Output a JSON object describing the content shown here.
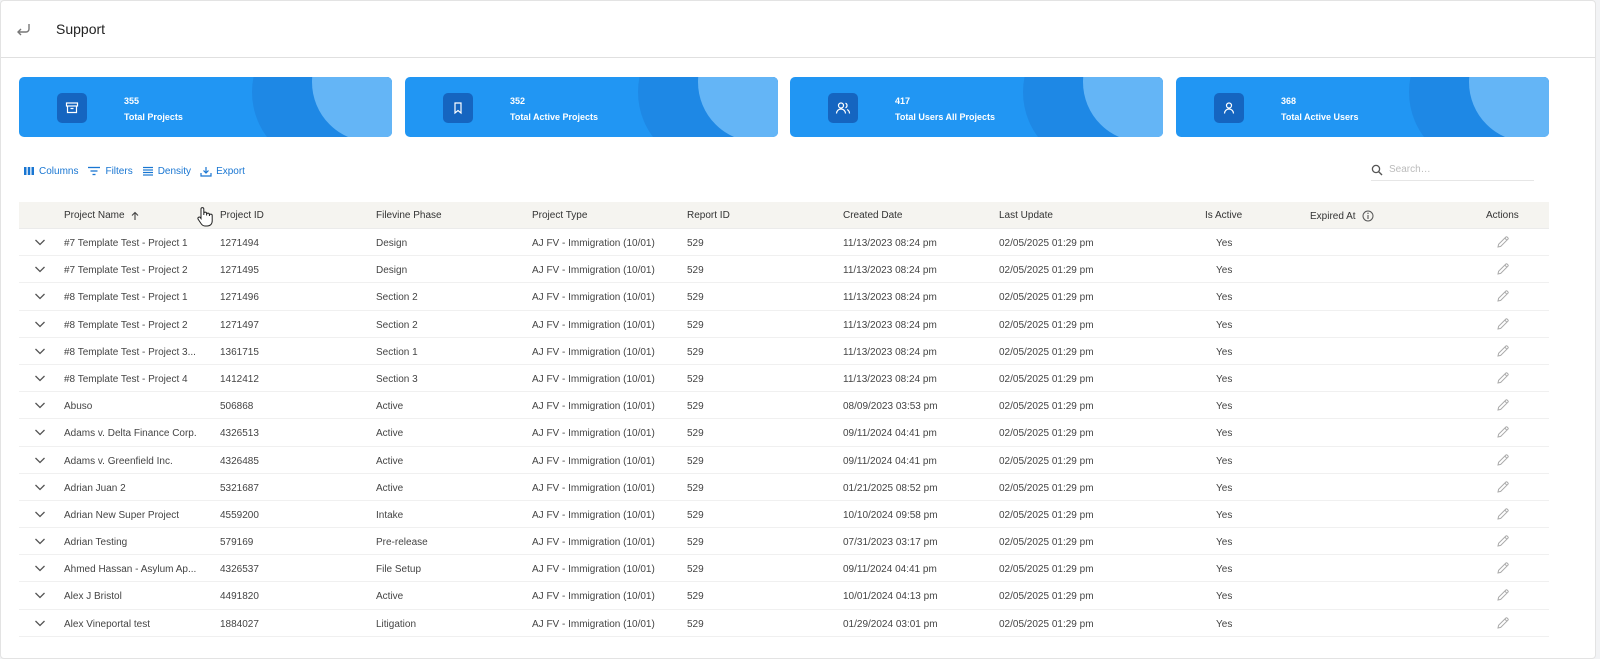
{
  "header": {
    "title": "Support"
  },
  "cards": [
    {
      "value": "355",
      "label": "Total Projects",
      "icon": "archive-icon"
    },
    {
      "value": "352",
      "label": "Total Active Projects",
      "icon": "bookmark-icon"
    },
    {
      "value": "417",
      "label": "Total Users All Projects",
      "icon": "users-icon"
    },
    {
      "value": "368",
      "label": "Total Active Users",
      "icon": "user-icon"
    }
  ],
  "toolbar": {
    "columns": "Columns",
    "filters": "Filters",
    "density": "Density",
    "export": "Export"
  },
  "search": {
    "placeholder": "Search…"
  },
  "columns": {
    "project_name": "Project Name",
    "project_id": "Project ID",
    "filevine_phase": "Filevine Phase",
    "project_type": "Project Type",
    "report_id": "Report ID",
    "created_date": "Created Date",
    "last_update": "Last Update",
    "is_active": "Is Active",
    "expired_at": "Expired At",
    "actions": "Actions"
  },
  "rows": [
    [
      "#7 Template Test - Project 1",
      "1271494",
      "Design",
      "AJ FV - Immigration (10/01)",
      "529",
      "11/13/2023 08:24 pm",
      "02/05/2025 01:29 pm",
      "Yes"
    ],
    [
      "#7 Template Test - Project 2",
      "1271495",
      "Design",
      "AJ FV - Immigration (10/01)",
      "529",
      "11/13/2023 08:24 pm",
      "02/05/2025 01:29 pm",
      "Yes"
    ],
    [
      "#8 Template Test - Project 1",
      "1271496",
      "Section 2",
      "AJ FV - Immigration (10/01)",
      "529",
      "11/13/2023 08:24 pm",
      "02/05/2025 01:29 pm",
      "Yes"
    ],
    [
      "#8 Template Test - Project 2",
      "1271497",
      "Section 2",
      "AJ FV - Immigration (10/01)",
      "529",
      "11/13/2023 08:24 pm",
      "02/05/2025 01:29 pm",
      "Yes"
    ],
    [
      "#8 Template Test - Project 3...",
      "1361715",
      "Section 1",
      "AJ FV - Immigration (10/01)",
      "529",
      "11/13/2023 08:24 pm",
      "02/05/2025 01:29 pm",
      "Yes"
    ],
    [
      "#8 Template Test - Project 4",
      "1412412",
      "Section 3",
      "AJ FV - Immigration (10/01)",
      "529",
      "11/13/2023 08:24 pm",
      "02/05/2025 01:29 pm",
      "Yes"
    ],
    [
      "Abuso",
      "506868",
      "Active",
      "AJ FV - Immigration (10/01)",
      "529",
      "08/09/2023 03:53 pm",
      "02/05/2025 01:29 pm",
      "Yes"
    ],
    [
      "Adams v. Delta Finance Corp.",
      "4326513",
      "Active",
      "AJ FV - Immigration (10/01)",
      "529",
      "09/11/2024 04:41 pm",
      "02/05/2025 01:29 pm",
      "Yes"
    ],
    [
      "Adams v. Greenfield Inc.",
      "4326485",
      "Active",
      "AJ FV - Immigration (10/01)",
      "529",
      "09/11/2024 04:41 pm",
      "02/05/2025 01:29 pm",
      "Yes"
    ],
    [
      "Adrian Juan 2",
      "5321687",
      "Active",
      "AJ FV - Immigration (10/01)",
      "529",
      "01/21/2025 08:52 pm",
      "02/05/2025 01:29 pm",
      "Yes"
    ],
    [
      "Adrian New Super Project",
      "4559200",
      "Intake",
      "AJ FV - Immigration (10/01)",
      "529",
      "10/10/2024 09:58 pm",
      "02/05/2025 01:29 pm",
      "Yes"
    ],
    [
      "Adrian Testing",
      "579169",
      "Pre-release",
      "AJ FV - Immigration (10/01)",
      "529",
      "07/31/2023 03:17 pm",
      "02/05/2025 01:29 pm",
      "Yes"
    ],
    [
      "Ahmed Hassan - Asylum Ap...",
      "4326537",
      "File Setup",
      "AJ FV - Immigration (10/01)",
      "529",
      "09/11/2024 04:41 pm",
      "02/05/2025 01:29 pm",
      "Yes"
    ],
    [
      "Alex J Bristol",
      "4491820",
      "Active",
      "AJ FV - Immigration (10/01)",
      "529",
      "10/01/2024 04:13 pm",
      "02/05/2025 01:29 pm",
      "Yes"
    ],
    [
      "Alex Vineportal test",
      "1884027",
      "Litigation",
      "AJ FV - Immigration (10/01)",
      "529",
      "01/29/2024 03:01 pm",
      "02/05/2025 01:29 pm",
      "Yes"
    ]
  ],
  "colors": {
    "card_bg": "#2196f3",
    "card_icon_bg": "#1565c0",
    "accent": "#1976d2"
  }
}
